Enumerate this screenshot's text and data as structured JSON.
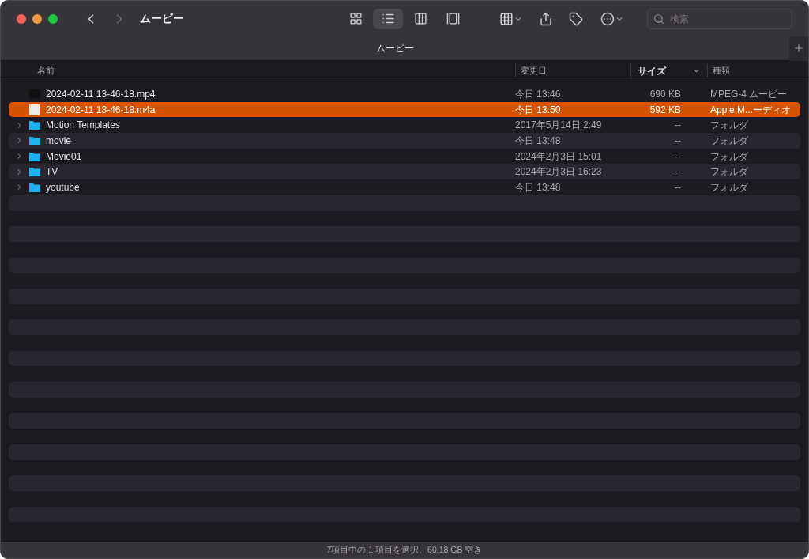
{
  "window": {
    "title": "ムービー"
  },
  "views": [
    {
      "kind": "icons",
      "selected": false
    },
    {
      "kind": "list",
      "selected": true
    },
    {
      "kind": "columns",
      "selected": false
    },
    {
      "kind": "gallery",
      "selected": false
    }
  ],
  "search": {
    "placeholder": "検索"
  },
  "tab": {
    "title": "ムービー"
  },
  "columns": [
    {
      "label": "名前",
      "sorted": false
    },
    {
      "label": "変更日",
      "sorted": false
    },
    {
      "label": "サイズ",
      "sorted": true
    },
    {
      "label": "種類",
      "sorted": false
    }
  ],
  "rows": [
    {
      "kind": "video",
      "name": "2024-02-11 13-46-18.mp4",
      "date": "今日 13:46",
      "size": "690 KB",
      "type": "MPEG-4 ムービー",
      "selected": false
    },
    {
      "kind": "audio",
      "name": "2024-02-11 13-46-18.m4a",
      "date": "今日 13:50",
      "size": "592 KB",
      "type": "Apple M...ーディオ",
      "selected": true
    },
    {
      "kind": "folder",
      "name": "Motion Templates",
      "date": "2017年5月14日 2:49",
      "size": "--",
      "type": "フォルダ",
      "selected": false,
      "expanded": false
    },
    {
      "kind": "folder",
      "name": "movie",
      "date": "今日 13:48",
      "size": "--",
      "type": "フォルダ",
      "selected": false,
      "expanded": false
    },
    {
      "kind": "folder",
      "name": "Movie01",
      "date": "2024年2月3日 15:01",
      "size": "--",
      "type": "フォルダ",
      "selected": false,
      "expanded": false
    },
    {
      "kind": "folder",
      "name": "TV",
      "date": "2024年2月3日 16:23",
      "size": "--",
      "type": "フォルダ",
      "selected": false,
      "expanded": false
    },
    {
      "kind": "folder",
      "name": "youtube",
      "date": "今日 13:48",
      "size": "--",
      "type": "フォルダ",
      "selected": false,
      "expanded": false
    }
  ],
  "status_bar": "7項目中の 1 項目を選択、60.18 GB 空き"
}
